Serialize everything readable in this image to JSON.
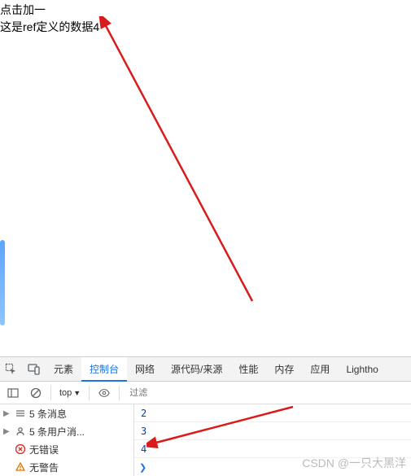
{
  "page": {
    "button_text": "点击加一",
    "ref_text": "这是ref定义的数据4"
  },
  "devtools": {
    "tabs": {
      "elements": "元素",
      "console": "控制台",
      "network": "网络",
      "sources": "源代码/来源",
      "performance": "性能",
      "memory": "内存",
      "application": "应用",
      "lighthouse": "Lightho"
    },
    "toolbar": {
      "context": "top",
      "filter_placeholder": "过滤"
    },
    "sidebar": {
      "messages": "5 条消息",
      "user_messages": "5 条用户消...",
      "no_errors": "无错误",
      "no_warnings": "无警告"
    },
    "logs": [
      "2",
      "3",
      "4"
    ]
  },
  "watermark": "CSDN @一只大黑洋"
}
